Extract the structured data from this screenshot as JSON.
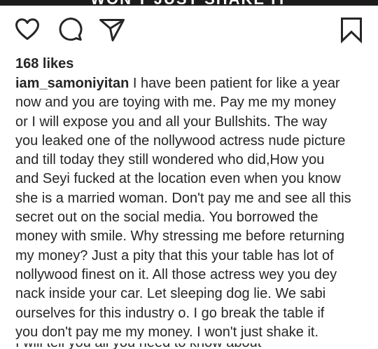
{
  "media": {
    "overlay_text": "WON'T JUST SHAKE IT"
  },
  "actions": {
    "like_icon": "heart-outline-icon",
    "comment_icon": "comment-bubble-icon",
    "share_icon": "paper-plane-icon",
    "save_icon": "bookmark-outline-icon"
  },
  "post": {
    "likes_text": "168 likes",
    "username": "iam_samoniyitan",
    "caption_lines": [
      " I have been patient for like a year",
      "now and you are toying with me. Pay me my money",
      "or I will expose you and all your Bullshits. The way",
      "you leaked one of the nollywood actress nude picture",
      "and till today they still wondered who did,How you",
      "and Seyi fucked at the location even when you know",
      "she is a married woman. Don't pay me and see all this",
      "secret out on the social media. You borrowed the",
      "money with smile. Why stressing me before returning",
      "my money? Just a pity that this your table has lot of",
      "nollywood finest on it. All those actress wey you dey",
      "nack inside your car. Let sleeping dog lie. We sabi",
      "ourselves for this industry o. I go break the table if",
      "you don't pay me my money. I won't just shake it."
    ],
    "cut_line": "I will tell you all you need to know about"
  }
}
